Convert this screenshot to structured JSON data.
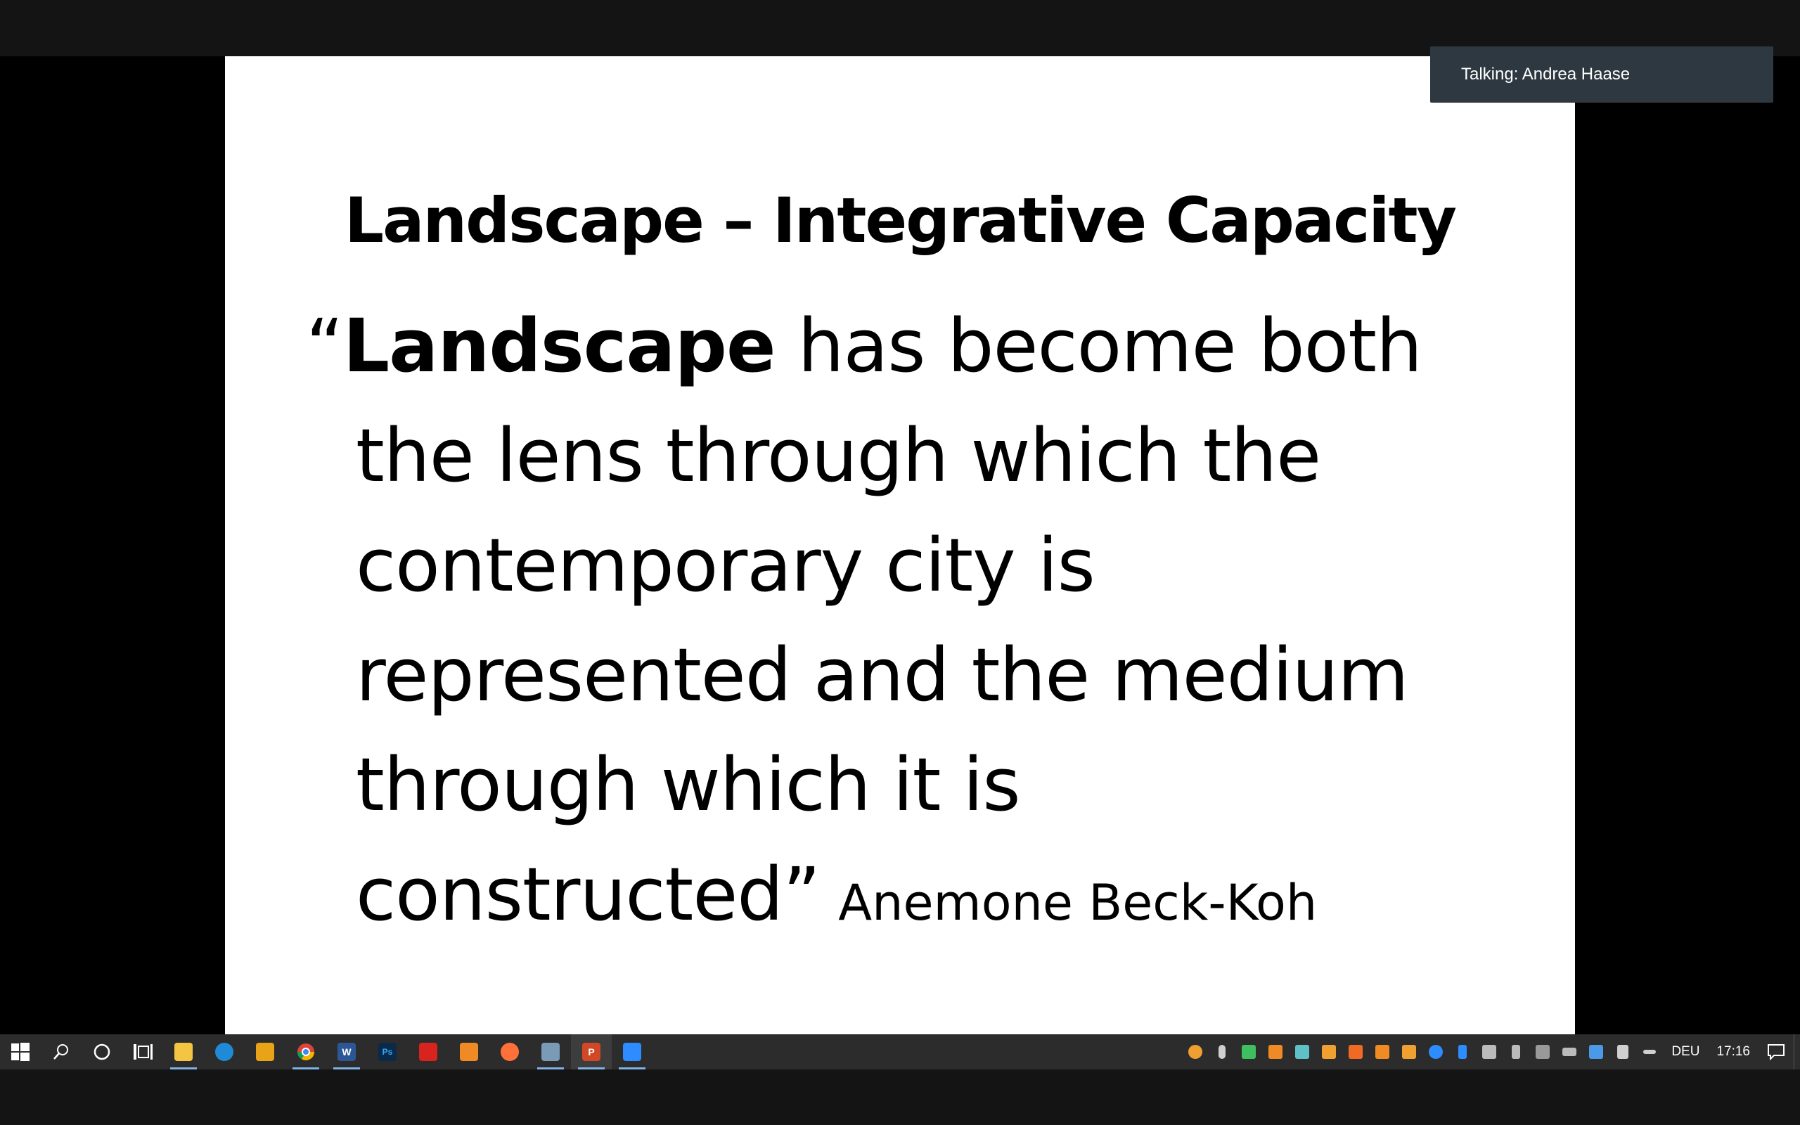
{
  "meeting": {
    "talking_label": "Talking: Andrea Haase"
  },
  "slide": {
    "title": "Landscape – Integrative Capacity",
    "quote": {
      "open_mark": "“",
      "bold_word": "Landscape",
      "line1_rest": " has become both",
      "line2": "the lens through which the",
      "line3": "contemporary city is",
      "line4": "represented and the medium",
      "line5": "through which it is",
      "line6": "constructed”",
      "author": "Anemone Beck-Koh"
    }
  },
  "taskbar": {
    "pinned": [
      {
        "name": "file-explorer",
        "active": true
      },
      {
        "name": "edge"
      },
      {
        "name": "media-player"
      },
      {
        "name": "chrome",
        "active": true
      },
      {
        "name": "word",
        "label": "W",
        "active": true
      },
      {
        "name": "photoshop",
        "label": "Ps"
      },
      {
        "name": "acrobat"
      },
      {
        "name": "app-orange"
      },
      {
        "name": "firefox"
      },
      {
        "name": "remote-desktop",
        "active": true
      },
      {
        "name": "powerpoint",
        "label": "P",
        "active": true,
        "focused": true
      },
      {
        "name": "zoom",
        "active": true
      }
    ],
    "language": "DEU",
    "time": "17:16"
  },
  "colors": {
    "taskbar_bg": "#2c2c2c",
    "talking_bg": "#2d3840",
    "active_indicator": "#7fb2e5"
  }
}
